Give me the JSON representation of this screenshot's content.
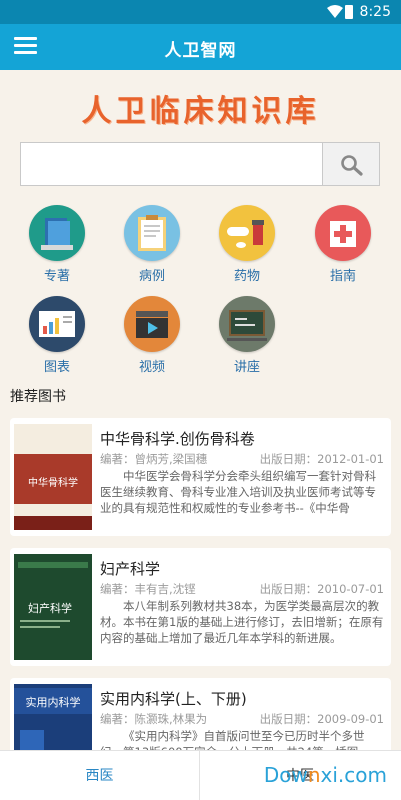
{
  "status_bar": {
    "time": "8:25"
  },
  "app_bar": {
    "title": "人卫智网",
    "menu_icon": "menu-icon"
  },
  "hero": {
    "title": "人卫临床知识库"
  },
  "search": {
    "value": "",
    "placeholder": "",
    "icon": "search-icon"
  },
  "categories": [
    {
      "label": "专著",
      "icon": "books-icon",
      "color": "#1f9b8a"
    },
    {
      "label": "病例",
      "icon": "clipboard-icon",
      "color": "#79c1e3"
    },
    {
      "label": "药物",
      "icon": "pills-icon",
      "color": "#f2c23e"
    },
    {
      "label": "指南",
      "icon": "first-aid-icon",
      "color": "#e8595a"
    },
    {
      "label": "图表",
      "icon": "chart-board-icon",
      "color": "#2d4a6b"
    },
    {
      "label": "视频",
      "icon": "video-clapper-icon",
      "color": "#e3873a"
    },
    {
      "label": "讲座",
      "icon": "chalkboard-icon",
      "color": "#6d7a6a"
    }
  ],
  "recommended": {
    "title": "推荐图书",
    "books": [
      {
        "name": "中华骨科学.创伤骨科卷",
        "editor": "编著：曾炳芳,梁国穗",
        "date": "出版日期：2012-01-01",
        "desc": "中华医学会骨科学分会牵头组织编写一套针对骨科医生继续教育、骨科专业准入培训及执业医师考试等专业的具有规范性和权威性的专业参考书--《中华骨",
        "cover_text": "中华骨科学"
      },
      {
        "name": "妇产科学",
        "editor": "编著：丰有吉,沈铿",
        "date": "出版日期：2010-07-01",
        "desc": "本八年制系列教材共38本，为医学类最高层次的教材。本书在第1版的基础上进行修订，去旧增新；在原有内容的基础上增加了最近几年本学科的新进展。",
        "cover_text": "妇产科学"
      },
      {
        "name": "实用内科学(上、下册)",
        "editor": "编著：陈灏珠,林果为",
        "date": "出版日期：2009-09-01",
        "desc": "《实用内科学》自首版问世至今已历时半个多世纪，第13版600万字余，分上下册，共24篇，插图",
        "cover_text": "实用内科学"
      }
    ]
  },
  "bottom_tabs": [
    {
      "label": "西医"
    },
    {
      "label": "中医"
    }
  ],
  "watermark": {
    "brand": "Dow",
    "accent": "n",
    "rest": "xi.com"
  }
}
